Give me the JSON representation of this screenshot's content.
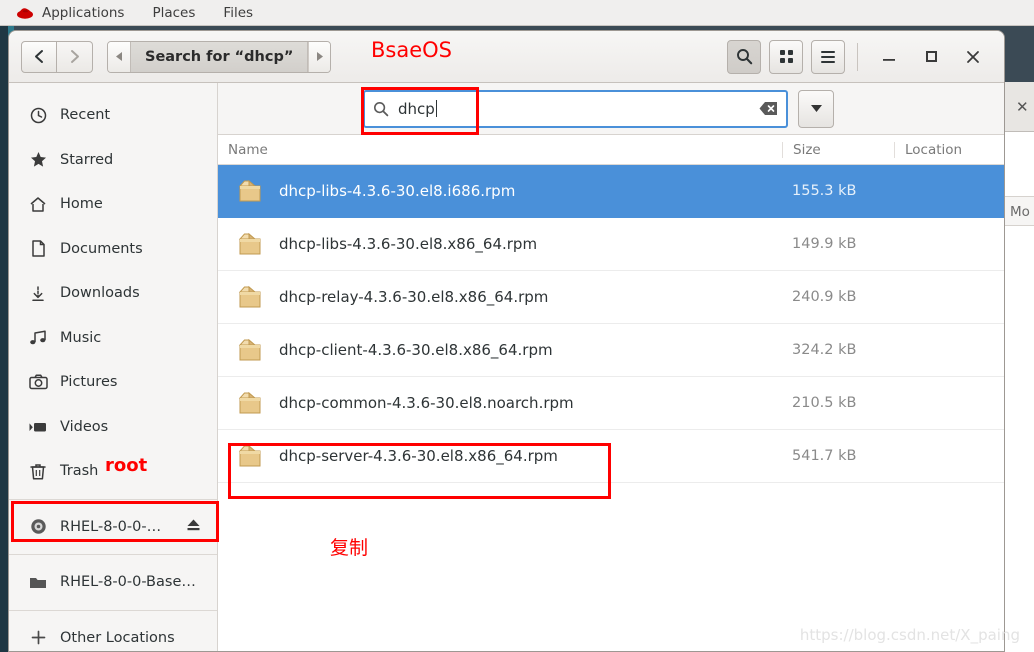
{
  "top_panel": {
    "logo_icon": "redhat-logo-icon",
    "items": [
      {
        "label": "Applications",
        "name": "applications"
      },
      {
        "label": "Places",
        "name": "places"
      },
      {
        "label": "Files",
        "name": "files"
      }
    ]
  },
  "window": {
    "nav": {
      "back_icon": "chevron-left-icon",
      "forward_icon": "chevron-right-icon"
    },
    "breadcrumb": {
      "left_arrow_icon": "triangle-left-icon",
      "label": "Search for “dhcp”",
      "right_arrow_icon": "triangle-right-icon"
    },
    "toolbar": {
      "search_icon": "search-icon",
      "grid_icon": "grid-view-icon",
      "menu_icon": "hamburger-menu-icon"
    },
    "controls": {
      "minimize": "–",
      "maximize": "□",
      "close": "✕"
    }
  },
  "sidebar": {
    "items": [
      {
        "label": "Recent",
        "icon": "clock-icon",
        "name": "recent",
        "eject": false
      },
      {
        "label": "Starred",
        "icon": "star-icon",
        "name": "starred",
        "eject": false
      },
      {
        "label": "Home",
        "icon": "home-icon",
        "name": "home",
        "eject": false
      },
      {
        "label": "Documents",
        "icon": "document-icon",
        "name": "documents",
        "eject": false
      },
      {
        "label": "Downloads",
        "icon": "download-icon",
        "name": "downloads",
        "eject": false
      },
      {
        "label": "Music",
        "icon": "music-note-icon",
        "name": "music",
        "eject": false
      },
      {
        "label": "Pictures",
        "icon": "camera-icon",
        "name": "pictures",
        "eject": false
      },
      {
        "label": "Videos",
        "icon": "video-icon",
        "name": "videos",
        "eject": false
      },
      {
        "label": "Trash",
        "icon": "trash-icon",
        "name": "trash",
        "eject": false
      }
    ],
    "devices": [
      {
        "label": "RHEL-8-0-0-…",
        "icon": "disc-icon",
        "name": "rhel-disc",
        "eject": true
      },
      {
        "label": "RHEL-8-0-0-Base…",
        "icon": "folder-icon",
        "name": "rhel-baseos",
        "eject": false
      }
    ],
    "other": {
      "label": "Other Locations",
      "icon": "plus-icon",
      "name": "other-locations"
    }
  },
  "search": {
    "icon": "search-icon",
    "value": "dhcp",
    "clear_icon": "clear-backspace-icon",
    "dropdown_icon": "chevron-down-icon"
  },
  "file_table": {
    "columns": [
      "Name",
      "Size",
      "Location"
    ],
    "rows": [
      {
        "name": "dhcp-libs-4.3.6-30.el8.i686.rpm",
        "size": "155.3 kB",
        "location": "",
        "selected": true,
        "icon": "rpm-package-icon"
      },
      {
        "name": "dhcp-libs-4.3.6-30.el8.x86_64.rpm",
        "size": "149.9 kB",
        "location": "",
        "selected": false,
        "icon": "rpm-package-icon"
      },
      {
        "name": "dhcp-relay-4.3.6-30.el8.x86_64.rpm",
        "size": "240.9 kB",
        "location": "",
        "selected": false,
        "icon": "rpm-package-icon"
      },
      {
        "name": "dhcp-client-4.3.6-30.el8.x86_64.rpm",
        "size": "324.2 kB",
        "location": "",
        "selected": false,
        "icon": "rpm-package-icon"
      },
      {
        "name": "dhcp-common-4.3.6-30.el8.noarch.rpm",
        "size": "210.5 kB",
        "location": "",
        "selected": false,
        "icon": "rpm-package-icon"
      },
      {
        "name": "dhcp-server-4.3.6-30.el8.x86_64.rpm",
        "size": "541.7 kB",
        "location": "",
        "selected": false,
        "icon": "rpm-package-icon"
      }
    ]
  },
  "background_window": {
    "close_icon": "close-icon",
    "column_fragment": "Mo"
  },
  "annotations": {
    "bsaeos": "BsaeOS",
    "root": "root",
    "copy_cn": "复制",
    "box_color": "#ff0000"
  },
  "watermark": "https://blog.csdn.net/X_paing"
}
